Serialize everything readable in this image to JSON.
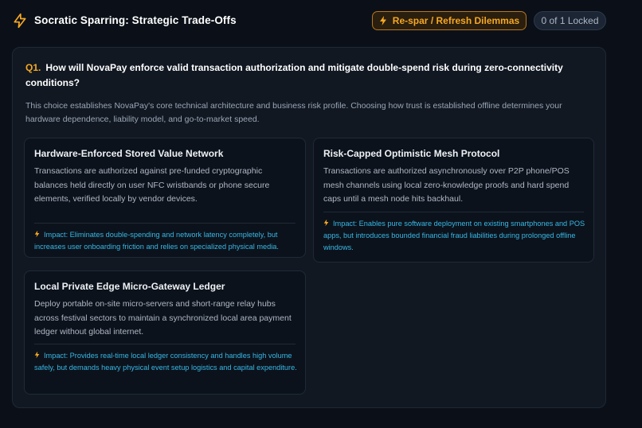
{
  "header": {
    "title": "Socratic Sparring: Strategic Trade-Offs",
    "logo_icon": "lightning-bolt-icon",
    "respar_label": "Re-spar / Refresh Dilemmas",
    "locked_status": "0 of 1 Locked"
  },
  "colors": {
    "accent": "#f6a823",
    "impact": "#38b8e6",
    "background": "#0b1018",
    "panel": "#111822"
  },
  "question": {
    "number": "Q1.",
    "text": "How will NovaPay enforce valid transaction authorization and mitigate double-spend risk during zero-connectivity conditions?",
    "context": "This choice establishes NovaPay's core technical architecture and business risk profile. Choosing how trust is established offline determines your hardware dependence, liability model, and go-to-market speed."
  },
  "options": [
    {
      "title": "Hardware-Enforced Stored Value Network",
      "description": "Transactions are authorized against pre-funded cryptographic balances held directly on user NFC wristbands or phone secure elements, verified locally by vendor devices.",
      "impact": "Impact: Eliminates double-spending and network latency completely, but increases user onboarding friction and relies on specialized physical media."
    },
    {
      "title": "Risk-Capped Optimistic Mesh Protocol",
      "description": "Transactions are authorized asynchronously over P2P phone/POS mesh channels using local zero-knowledge proofs and hard spend caps until a mesh node hits backhaul.",
      "impact": "Impact: Enables pure software deployment on existing smartphones and POS apps, but introduces bounded financial fraud liabilities during prolonged offline windows."
    },
    {
      "title": "Local Private Edge Micro-Gateway Ledger",
      "description": "Deploy portable on-site micro-servers and short-range relay hubs across festival sectors to maintain a synchronized local area payment ledger without global internet.",
      "impact": "Impact: Provides real-time local ledger consistency and handles high volume safely, but demands heavy physical event setup logistics and capital expenditure."
    }
  ]
}
